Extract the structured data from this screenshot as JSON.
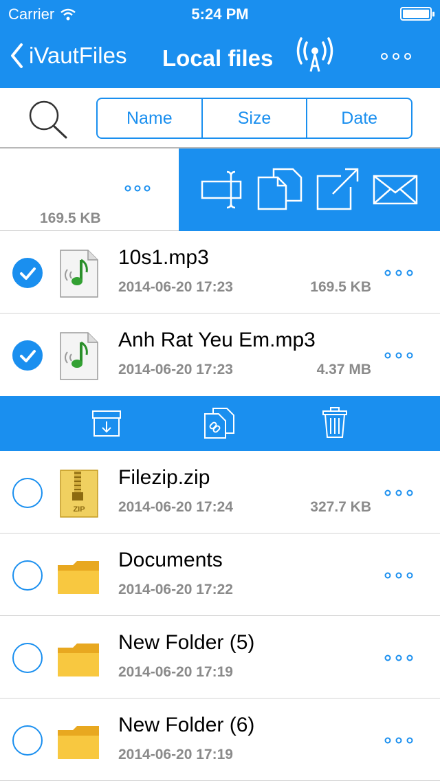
{
  "status_bar": {
    "carrier": "Carrier",
    "time": "5:24 PM"
  },
  "nav": {
    "back_label": "iVautFiles",
    "title": "Local files"
  },
  "sort": {
    "options": [
      "Name",
      "Size",
      "Date"
    ]
  },
  "swiped_item": {
    "size": "169.5 KB"
  },
  "files": [
    {
      "name": "10s1.mp3",
      "date": "2014-06-20 17:23",
      "size": "169.5 KB",
      "type": "audio",
      "checked": true
    },
    {
      "name": "Anh Rat Yeu Em.mp3",
      "date": "2014-06-20 17:23",
      "size": "4.37 MB",
      "type": "audio",
      "checked": true
    },
    {
      "name": "Filezip.zip",
      "date": "2014-06-20 17:24",
      "size": "327.7 KB",
      "type": "zip",
      "checked": false
    },
    {
      "name": "Documents",
      "date": "2014-06-20 17:22",
      "size": "",
      "type": "folder",
      "checked": false
    },
    {
      "name": "New Folder (5)",
      "date": "2014-06-20 17:19",
      "size": "",
      "type": "folder",
      "checked": false
    },
    {
      "name": "New Folder (6)",
      "date": "2014-06-20 17:19",
      "size": "",
      "type": "folder",
      "checked": false
    }
  ],
  "icons": {
    "status": [
      "wifi-signal-icon",
      "battery-icon"
    ],
    "nav": [
      "back-chevron-icon",
      "wifi-transfer-icon",
      "more-icon"
    ],
    "search": "search-icon",
    "swipe_actions": [
      "rename-icon",
      "copy-icon",
      "open-in-icon",
      "mail-icon"
    ],
    "toolbar": [
      "move-to-folder-icon",
      "link-icon",
      "trash-icon"
    ]
  },
  "colors": {
    "accent": "#1a8fef",
    "secondary_text": "#8a8a8a",
    "divider": "#d2d2d2"
  }
}
